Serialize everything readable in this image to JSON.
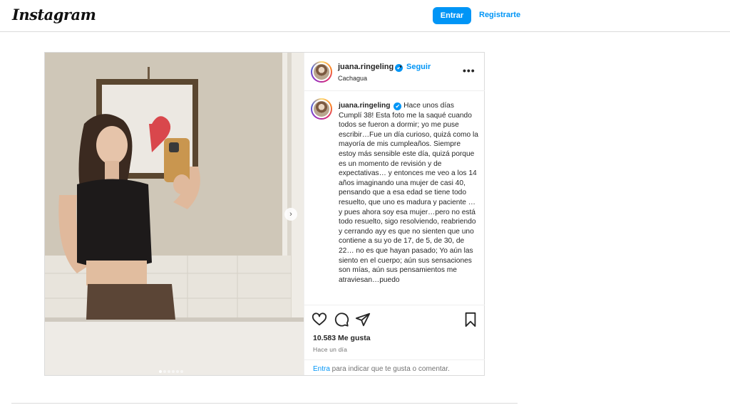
{
  "header": {
    "logo_text": "Instagram",
    "login_label": "Entrar",
    "signup_label": "Registrarte"
  },
  "post": {
    "username": "juana.ringeling",
    "verified_icon": "✔",
    "separator": "•",
    "follow_label": "Seguir",
    "location": "Cachagua",
    "more_label": "•••",
    "caption_username": "juana.ringeling",
    "caption_text": "Hace unos días Cumplí 38! Esta foto me la saqué cuando todos se fueron a dormir; yo me puse escribir…Fue un día curioso, quizá como la mayoría de mis cumpleaños. Siempre estoy más sensible este día, quizá porque es un momento de revisión y de expectativas… y entonces me veo a los 14 años imaginando una mujer de casi 40, pensando que a esa edad se tiene todo resuelto, que uno es madura y paciente …y pues ahora soy esa mujer…pero no está todo resuelto, sigo resolviendo, reabriendo y cerrando ayy es que no sienten que uno contiene a su yo de 17, de 5, de 30, de 22… no es que hayan pasado; Yo aún las siento en el cuerpo; aún sus sensaciones son mías, aún sus pensamientos me atraviesan…puedo",
    "likes": "10.583 Me gusta",
    "time_ago": "Hace un día",
    "comment_login_link": "Entra",
    "comment_prompt": " para indicar que te gusta o comentar.",
    "carousel": {
      "total": 6,
      "active": 0
    },
    "next_arrow": "›",
    "icons": [
      "heart-icon",
      "comment-icon",
      "share-icon",
      "bookmark-icon"
    ],
    "colors": {
      "accent": "#0095f6",
      "text": "#262626",
      "muted": "#737373",
      "border": "#dbdbdb"
    }
  }
}
